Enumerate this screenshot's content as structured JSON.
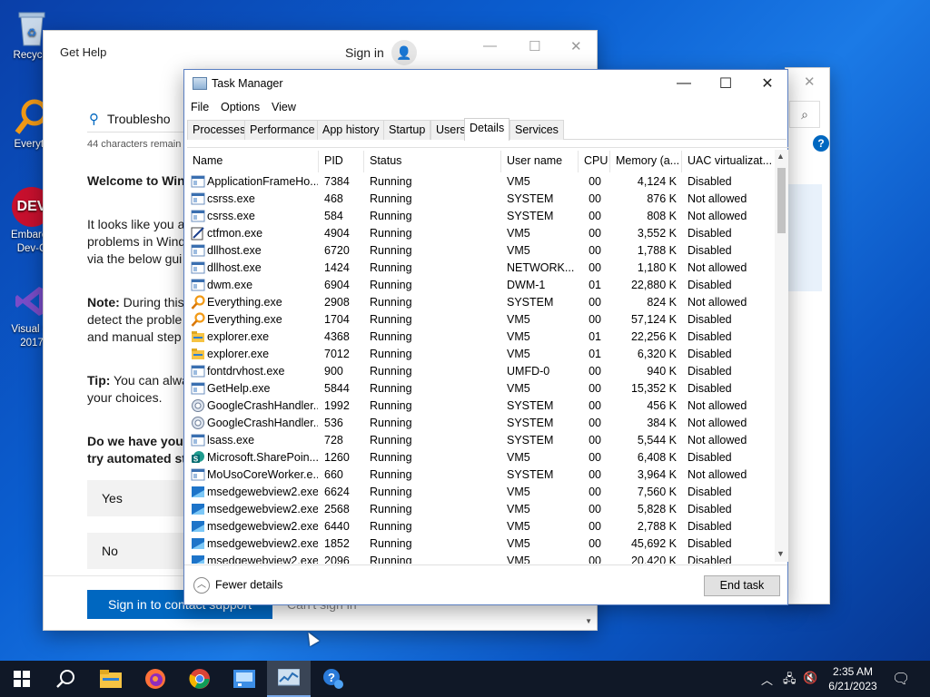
{
  "desktop": {
    "icons": [
      {
        "label": "Recycle",
        "icon": "recycle-bin-icon",
        "color": "#9bb7d6"
      },
      {
        "label": "Everyth",
        "icon": "everything-search-icon",
        "color": "#f29a16"
      },
      {
        "label": "Embarca Dev-C",
        "icon": "dev-cpp-icon",
        "color": "#c8102e"
      },
      {
        "label": "Visual St 2017",
        "icon": "visual-studio-icon",
        "color": "#7a4dc9"
      }
    ]
  },
  "gethelp": {
    "title": "Get Help",
    "sign_in": "Sign in",
    "search_value": "Troublesho",
    "chars_remaining": "44 characters remain",
    "welcome": "Welcome to Win",
    "para1": [
      "It looks like you a",
      "problems in Wind",
      "via the below gui"
    ],
    "note_label": "Note:",
    "note_rest": " During this",
    "note_lines": [
      "detect the proble",
      " and manual step"
    ],
    "tip_label": "Tip:",
    "tip_rest": " You can alwa",
    "tip_line2": "your choices.",
    "question": [
      "Do we have your",
      "try automated st"
    ],
    "yes": "Yes",
    "no": "No",
    "primary_button": "Sign in to contact support",
    "secondary_button": "Can't sign in"
  },
  "taskmanager": {
    "title": "Task Manager",
    "menu": [
      "File",
      "Options",
      "View"
    ],
    "tabs": [
      "Processes",
      "Performance",
      "App history",
      "Startup",
      "Users",
      "Details",
      "Services"
    ],
    "active_tab": "Details",
    "columns": [
      "Name",
      "PID",
      "Status",
      "User name",
      "CPU",
      "Memory (a...",
      "UAC virtualizat..."
    ],
    "rows": [
      {
        "name": "ApplicationFrameHo...",
        "pid": "7384",
        "status": "Running",
        "user": "VM5",
        "cpu": "00",
        "mem": "4,124 K",
        "uac": "Disabled",
        "icon": "app-icon"
      },
      {
        "name": "csrss.exe",
        "pid": "468",
        "status": "Running",
        "user": "SYSTEM",
        "cpu": "00",
        "mem": "876 K",
        "uac": "Not allowed",
        "icon": "app-icon"
      },
      {
        "name": "csrss.exe",
        "pid": "584",
        "status": "Running",
        "user": "SYSTEM",
        "cpu": "00",
        "mem": "808 K",
        "uac": "Not allowed",
        "icon": "app-icon"
      },
      {
        "name": "ctfmon.exe",
        "pid": "4904",
        "status": "Running",
        "user": "VM5",
        "cpu": "00",
        "mem": "3,552 K",
        "uac": "Disabled",
        "icon": "pen-icon"
      },
      {
        "name": "dllhost.exe",
        "pid": "6720",
        "status": "Running",
        "user": "VM5",
        "cpu": "00",
        "mem": "1,788 K",
        "uac": "Disabled",
        "icon": "app-icon"
      },
      {
        "name": "dllhost.exe",
        "pid": "1424",
        "status": "Running",
        "user": "NETWORK...",
        "cpu": "00",
        "mem": "1,180 K",
        "uac": "Not allowed",
        "icon": "app-icon"
      },
      {
        "name": "dwm.exe",
        "pid": "6904",
        "status": "Running",
        "user": "DWM-1",
        "cpu": "01",
        "mem": "22,880 K",
        "uac": "Disabled",
        "icon": "app-icon"
      },
      {
        "name": "Everything.exe",
        "pid": "2908",
        "status": "Running",
        "user": "SYSTEM",
        "cpu": "00",
        "mem": "824 K",
        "uac": "Not allowed",
        "icon": "magnifier-icon"
      },
      {
        "name": "Everything.exe",
        "pid": "1704",
        "status": "Running",
        "user": "VM5",
        "cpu": "00",
        "mem": "57,124 K",
        "uac": "Disabled",
        "icon": "magnifier-icon"
      },
      {
        "name": "explorer.exe",
        "pid": "4368",
        "status": "Running",
        "user": "VM5",
        "cpu": "01",
        "mem": "22,256 K",
        "uac": "Disabled",
        "icon": "folder-icon"
      },
      {
        "name": "explorer.exe",
        "pid": "7012",
        "status": "Running",
        "user": "VM5",
        "cpu": "01",
        "mem": "6,320 K",
        "uac": "Disabled",
        "icon": "folder-icon"
      },
      {
        "name": "fontdrvhost.exe",
        "pid": "900",
        "status": "Running",
        "user": "UMFD-0",
        "cpu": "00",
        "mem": "940 K",
        "uac": "Disabled",
        "icon": "app-icon"
      },
      {
        "name": "GetHelp.exe",
        "pid": "5844",
        "status": "Running",
        "user": "VM5",
        "cpu": "00",
        "mem": "15,352 K",
        "uac": "Disabled",
        "icon": "app-icon"
      },
      {
        "name": "GoogleCrashHandler....",
        "pid": "1992",
        "status": "Running",
        "user": "SYSTEM",
        "cpu": "00",
        "mem": "456 K",
        "uac": "Not allowed",
        "icon": "crash-handler-icon"
      },
      {
        "name": "GoogleCrashHandler....",
        "pid": "536",
        "status": "Running",
        "user": "SYSTEM",
        "cpu": "00",
        "mem": "384 K",
        "uac": "Not allowed",
        "icon": "crash-handler-icon"
      },
      {
        "name": "lsass.exe",
        "pid": "728",
        "status": "Running",
        "user": "SYSTEM",
        "cpu": "00",
        "mem": "5,544 K",
        "uac": "Not allowed",
        "icon": "app-icon"
      },
      {
        "name": "Microsoft.SharePoin...",
        "pid": "1260",
        "status": "Running",
        "user": "VM5",
        "cpu": "00",
        "mem": "6,408 K",
        "uac": "Disabled",
        "icon": "sharepoint-icon"
      },
      {
        "name": "MoUsoCoreWorker.e...",
        "pid": "660",
        "status": "Running",
        "user": "SYSTEM",
        "cpu": "00",
        "mem": "3,964 K",
        "uac": "Not allowed",
        "icon": "app-icon"
      },
      {
        "name": "msedgewebview2.exe",
        "pid": "6624",
        "status": "Running",
        "user": "VM5",
        "cpu": "00",
        "mem": "7,560 K",
        "uac": "Disabled",
        "icon": "edge-webview-icon"
      },
      {
        "name": "msedgewebview2.exe",
        "pid": "2568",
        "status": "Running",
        "user": "VM5",
        "cpu": "00",
        "mem": "5,828 K",
        "uac": "Disabled",
        "icon": "edge-webview-icon"
      },
      {
        "name": "msedgewebview2.exe",
        "pid": "6440",
        "status": "Running",
        "user": "VM5",
        "cpu": "00",
        "mem": "2,788 K",
        "uac": "Disabled",
        "icon": "edge-webview-icon"
      },
      {
        "name": "msedgewebview2.exe",
        "pid": "1852",
        "status": "Running",
        "user": "VM5",
        "cpu": "00",
        "mem": "45,692 K",
        "uac": "Disabled",
        "icon": "edge-webview-icon"
      },
      {
        "name": "msedgewebview2.exe",
        "pid": "2096",
        "status": "Running",
        "user": "VM5",
        "cpu": "00",
        "mem": "20,420 K",
        "uac": "Disabled",
        "icon": "edge-webview-icon"
      }
    ],
    "fewer_details": "Fewer details",
    "end_task": "End task"
  },
  "taskbar": {
    "apps": [
      "start-icon",
      "search-icon",
      "file-explorer-icon",
      "firefox-icon",
      "chrome-icon",
      "control-panel-icon",
      "task-manager-icon",
      "get-help-icon"
    ],
    "active_app": "task-manager-icon",
    "time": "2:35 AM",
    "date": "6/21/2023"
  },
  "colors": {
    "accent": "#0067c0",
    "desktop": "#0b5fd1",
    "taskbar": "#101827"
  }
}
